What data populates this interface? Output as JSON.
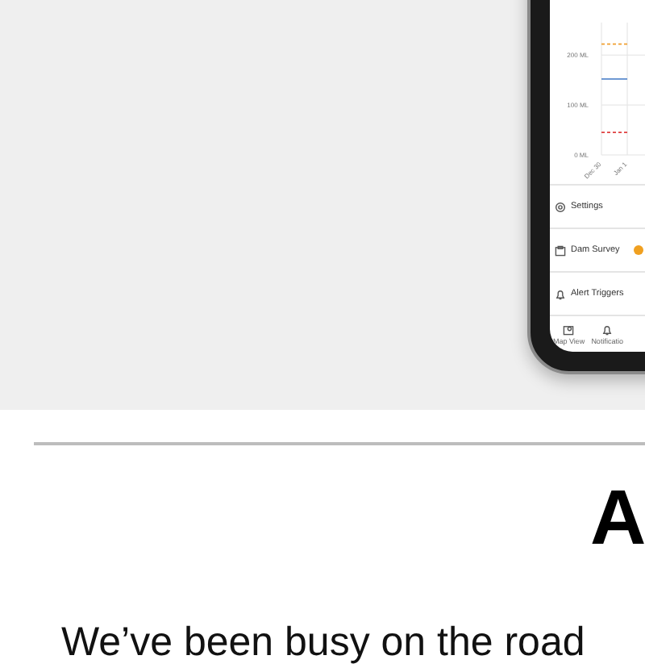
{
  "phone": {
    "chart_data": {
      "type": "line",
      "categories": [
        "Dec 30",
        "Jan 1"
      ],
      "ylim": [
        0,
        265
      ],
      "grid": true,
      "yticks": [
        {
          "value": 0,
          "label": "0 ML"
        },
        {
          "value": 100,
          "label": "100 ML"
        },
        {
          "value": 200,
          "label": "200 ML"
        }
      ],
      "series": [
        {
          "color": "#f0a030",
          "values": [
            222,
            222
          ],
          "line_style": "dashed"
        },
        {
          "color": "#4a7fc8",
          "values": [
            152,
            152
          ],
          "line_style": "solid"
        },
        {
          "color": "#e04040",
          "values": [
            45,
            45
          ],
          "line_style": "dashed"
        }
      ]
    },
    "menu": [
      {
        "label": "Settings",
        "kind": "settings"
      },
      {
        "label": "Dam Survey",
        "kind": "survey",
        "color": "#f0a020"
      },
      {
        "label": "Alert Triggers",
        "kind": "alert"
      }
    ],
    "nav": [
      {
        "label": "Map View",
        "kind": "map"
      },
      {
        "label": "Notificatio",
        "kind": "bell"
      }
    ]
  },
  "heading": "A",
  "intro": "We’ve been busy on the road"
}
